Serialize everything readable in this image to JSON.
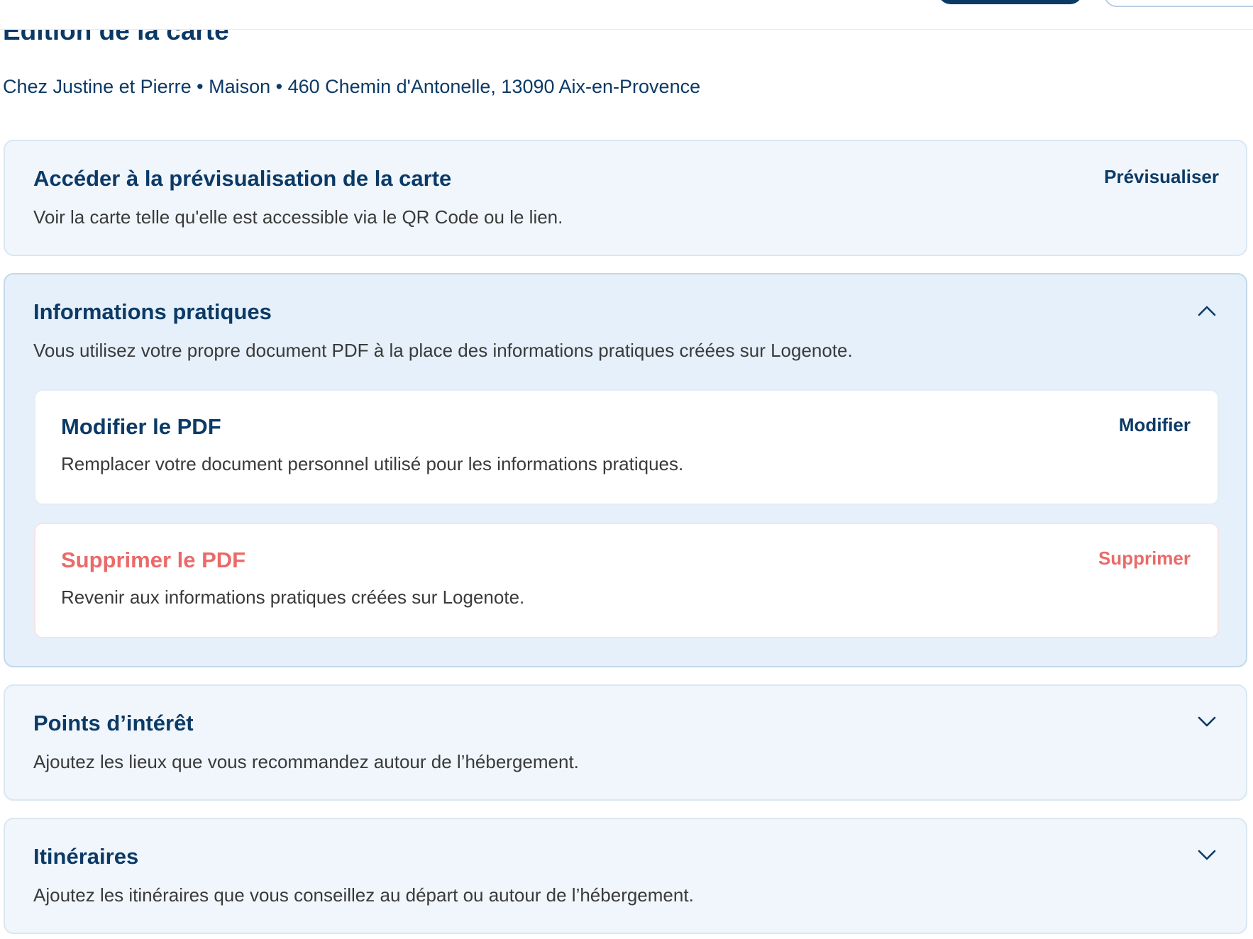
{
  "page": {
    "title": "Edition de la carte",
    "subtitle": "Chez Justine et Pierre • Maison • 460 Chemin d'Antonelle, 13090 Aix-en-Provence"
  },
  "preview_card": {
    "title": "Accéder à la prévisualisation de la carte",
    "description": "Voir la carte telle qu'elle est accessible via le QR Code ou le lien.",
    "action": "Prévisualiser"
  },
  "practical_info": {
    "title": "Informations pratiques",
    "description": "Vous utilisez votre propre document PDF à la place des informations pratiques créées sur Logenote.",
    "expanded": true,
    "modify_pdf": {
      "title": "Modifier le PDF",
      "description": "Remplacer votre document personnel utilisé pour les informations pratiques.",
      "action": "Modifier"
    },
    "delete_pdf": {
      "title": "Supprimer le PDF",
      "description": "Revenir aux informations pratiques créées sur Logenote.",
      "action": "Supprimer"
    }
  },
  "points_of_interest": {
    "title": "Points d’intérêt",
    "description": "Ajoutez les lieux que vous recommandez autour de l’hébergement.",
    "expanded": false
  },
  "itineraries": {
    "title": "Itinéraires",
    "description": "Ajoutez les itinéraires que vous conseillez au départ ou autour de l’hébergement.",
    "expanded": false
  },
  "icons": {
    "collapse": "chevron-up-icon",
    "expand": "chevron-down-icon"
  },
  "colors": {
    "primary": "#0c3a66",
    "danger": "#ea6a6a",
    "card_bg": "#f0f6fc",
    "card_expanded_bg": "#e5f0fa",
    "text": "#3a3a3a"
  }
}
